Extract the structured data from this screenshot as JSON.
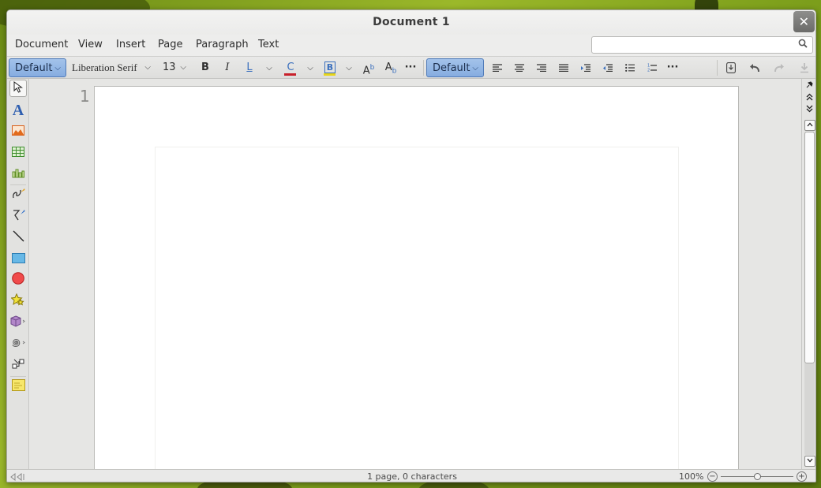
{
  "window": {
    "title": "Document 1",
    "close_glyph": "✕"
  },
  "menu": {
    "items": [
      "Document",
      "View",
      "Insert",
      "Page",
      "Paragraph",
      "Text"
    ],
    "search_placeholder": "",
    "search_icon": "search-icon"
  },
  "toolbar": {
    "paragraph_style": "Default",
    "font_name": "Liberation Serif",
    "font_size": "13",
    "bold": "B",
    "italic": "I",
    "underline": "L",
    "font_color": "C",
    "highlight": "B",
    "superscript_base": "A",
    "superscript_mark": "b",
    "subscript_base": "A",
    "subscript_mark": "b",
    "more": "···",
    "page_style": "Default",
    "more2": "···",
    "colors": {
      "accent": "#86ace0",
      "font_color_bar": "#c8202a",
      "highlight_bar": "#e8d51a"
    }
  },
  "left_tools": [
    "pointer-icon",
    "text-icon",
    "image-icon",
    "table-icon",
    "chart-icon",
    "curve-icon",
    "polygon-icon",
    "line-icon",
    "rectangle-icon",
    "ellipse-icon",
    "star-icon",
    "cube-icon",
    "spiral-icon",
    "connector-icon",
    "note-icon"
  ],
  "document": {
    "page_number": "1"
  },
  "status": {
    "summary": "1 page, 0 characters",
    "zoom": "100%",
    "zoom_level": 0.5,
    "zoom_minus": "−",
    "zoom_plus": "+"
  }
}
